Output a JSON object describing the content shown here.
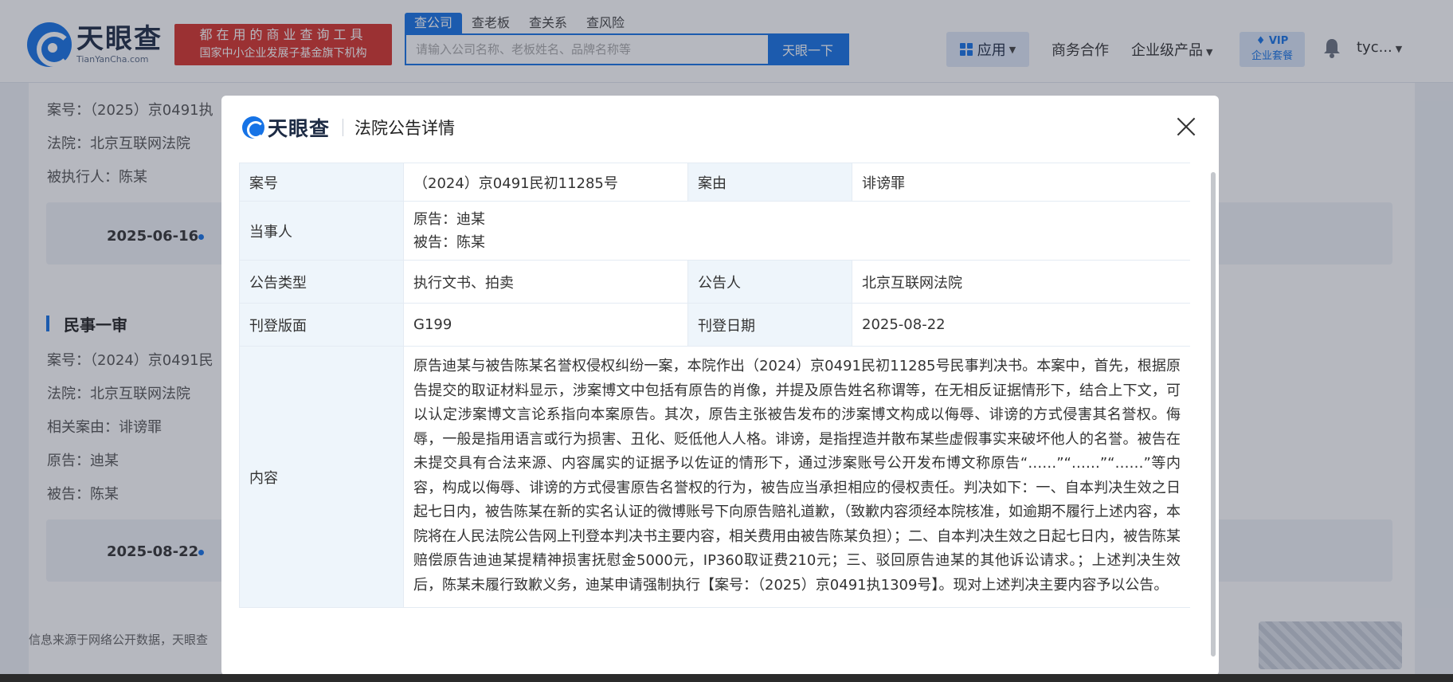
{
  "header": {
    "logo_name": "天眼查",
    "logo_domain": "TianYanCha.com",
    "promo_line1": "都在用的商业查询工具",
    "promo_line2": "国家中小企业发展子基金旗下机构",
    "search_tabs": [
      "查公司",
      "查老板",
      "查关系",
      "查风险"
    ],
    "search_placeholder": "请输入公司名称、老板姓名、品牌名称等",
    "search_button": "天眼一下",
    "nav": {
      "apps": "应用",
      "business": "商务合作",
      "enterprise": "企业级产品",
      "vip_top": "VIP",
      "vip_bottom": "企业套餐",
      "user": "tyc..."
    }
  },
  "background": {
    "case1_no": "案号：（2025）京0491执",
    "case1_court": "法院：北京互联网法院",
    "case1_executed": "被执行人：陈某",
    "date1": "2025-06-16",
    "section_title": "民事一审",
    "case2_no": "案号：（2024）京0491民",
    "case2_court": "法院：北京互联网法院",
    "case2_cause": "相关案由：诽谤罪",
    "case2_plaintiff": "原告：迪某",
    "case2_defendant": "被告：陈某",
    "date2": "2025-08-22",
    "footer": "信息来源于网络公开数据，天眼查"
  },
  "modal": {
    "logo_name": "天眼查",
    "title": "法院公告详情",
    "rows": {
      "case_no_label": "案号",
      "case_no_value": "（2024）京0491民初11285号",
      "cause_label": "案由",
      "cause_value": "诽谤罪",
      "parties_label": "当事人",
      "plaintiff": "原告：迪某",
      "defendant": "被告：陈某",
      "type_label": "公告类型",
      "type_value": "执行文书、拍卖",
      "announcer_label": "公告人",
      "announcer_value": "北京互联网法院",
      "page_label": "刊登版面",
      "page_value": "G199",
      "date_label": "刊登日期",
      "date_value": "2025-08-22",
      "content_label": "内容",
      "content_value": "原告迪某与被告陈某名誉权侵权纠纷一案，本院作出（2024）京0491民初11285号民事判决书。本案中，首先，根据原告提交的取证材料显示，涉案博文中包括有原告的肖像，并提及原告姓名称谓等，在无相反证据情形下，结合上下文，可以认定涉案博文言论系指向本案原告。其次，原告主张被告发布的涉案博文构成以侮辱、诽谤的方式侵害其名誉权。侮辱，一般是指用语言或行为损害、丑化、贬低他人人格。诽谤，是指捏造并散布某些虚假事实来破坏他人的名誉。被告在未提交具有合法来源、内容属实的证据予以佐证的情形下，通过涉案账号公开发布博文称原告“……”“……”“……”等内容，构成以侮辱、诽谤的方式侵害原告名誉权的行为，被告应当承担相应的侵权责任。判决如下：一、自本判决生效之日起七日内，被告陈某在新的实名认证的微博账号下向原告赔礼道歉，（致歉内容须经本院核准，如逾期不履行上述内容，本院将在人民法院公告网上刊登本判决书主要内容，相关费用由被告陈某负担）；二、自本判决生效之日起七日内，被告陈某赔偿原告迪迪某提精神损害抚慰金5000元，IP360取证费210元；三、驳回原告迪某的其他诉讼请求。；上述判决生效后，陈某未履行致歉义务，迪某申请强制执行【案号：（2025）京0491执1309号】。现对上述判决主要内容予以公告。"
    }
  }
}
